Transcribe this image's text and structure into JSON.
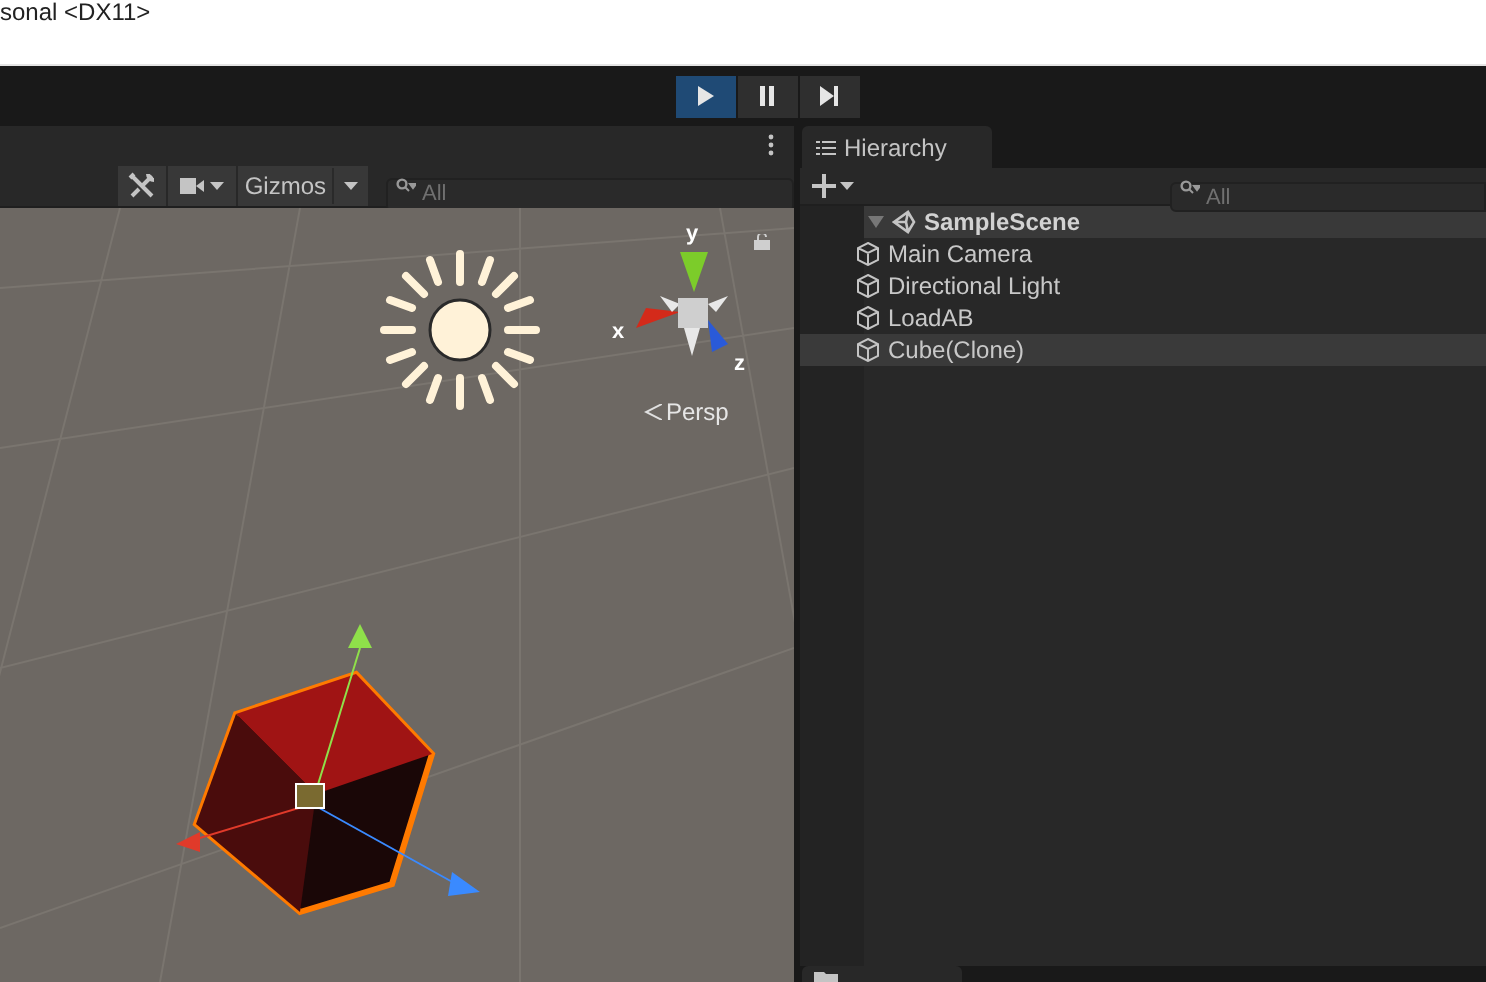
{
  "window": {
    "title": "sonal <DX11>"
  },
  "play_controls": [
    {
      "kind": "play",
      "selected": true
    },
    {
      "kind": "pause",
      "selected": false
    },
    {
      "kind": "step",
      "selected": false
    }
  ],
  "scene_view": {
    "toolbar": {
      "gizmos": "Gizmos",
      "search": {
        "placeholder": "All"
      }
    },
    "axis_gizmo": {
      "labels": [
        "y",
        "x",
        "z"
      ],
      "projection": "Persp"
    }
  },
  "hierarchy": {
    "tab": "Hierarchy",
    "search": {
      "placeholder": "All"
    },
    "tree": [
      {
        "label": "SampleScene",
        "expanded": true,
        "children": [
          {
            "label": "Main Camera",
            "selected": false
          },
          {
            "label": "Directional Light",
            "selected": false
          },
          {
            "label": "LoadAB",
            "selected": false
          },
          {
            "label": "Cube(Clone)",
            "selected": true
          }
        ]
      }
    ]
  }
}
